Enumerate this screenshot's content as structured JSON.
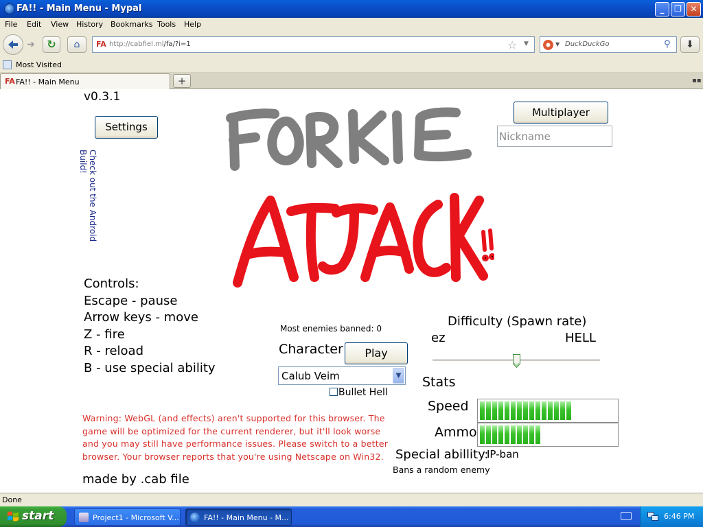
{
  "window": {
    "title": "FA!! - Main Menu - Mypal",
    "minimize_icon": "minimize-icon",
    "maximize_icon": "restore-icon",
    "close_icon": "close-icon"
  },
  "menubar": {
    "items": [
      "File",
      "Edit",
      "View",
      "History",
      "Bookmarks",
      "Tools",
      "Help"
    ]
  },
  "navbar": {
    "url_host": "http://cabfiel.ml",
    "url_path": "/fa/?i=1",
    "search_placeholder": "DuckDuckGo"
  },
  "bookmarks": {
    "items": [
      "Most Visited"
    ]
  },
  "tabs": {
    "items": [
      {
        "label": "FA!! - Main Menu",
        "active": true
      }
    ],
    "new_tab_label": "+"
  },
  "page": {
    "version": "v0.3.1",
    "settings_label": "Settings",
    "multiplayer_label": "Multiplayer",
    "nickname_placeholder": "Nickname",
    "android_link": "Check out the Android Build!",
    "logo_line1": "FORKIE",
    "logo_line2": "ATTACK!!",
    "controls": [
      "Controls:",
      "Escape - pause",
      "Arrow keys - move",
      "Z - fire",
      "R - reload",
      "B - use special ability"
    ],
    "most_banned": "Most enemies banned: 0",
    "character_label": "Character",
    "play_label": "Play",
    "character_selected": "Calub Veim",
    "bullet_hell_label": "Bullet Hell",
    "bullet_hell_checked": false,
    "warning": "Warning: WebGL (and effects) aren't supported for this browser. The game will be optimized for the current renderer, but it'll look worse and you may still have performance issues. Please switch to a better browser. Your browser reports that you're using Netscape on Win32.",
    "made_by": "made by .cab file",
    "difficulty": {
      "label": "Difficulty (Spawn rate)",
      "min_label": "ez",
      "max_label": "HELL",
      "value": 0.5
    },
    "stats": {
      "label": "Stats",
      "speed_label": "Speed",
      "speed_value": 0.67,
      "ammo_label": "Ammo",
      "ammo_value": 0.47
    },
    "special_ability_label": "Special abillity:",
    "special_ability_value": "IP-ban",
    "special_ability_desc": "Bans a random enemy"
  },
  "colors": {
    "logo_gray": "#7f7f7f",
    "logo_red": "#e8141b",
    "warning_red": "#d8302a",
    "link_blue": "#1c2b8c",
    "bar_green": "#39c22b"
  },
  "statusbar": {
    "text": "Done"
  },
  "taskbar": {
    "start_label": "start",
    "tasks": [
      "Project1 - Microsoft V...",
      "FA!! - Main Menu - M..."
    ],
    "clock": "6:46 PM"
  }
}
